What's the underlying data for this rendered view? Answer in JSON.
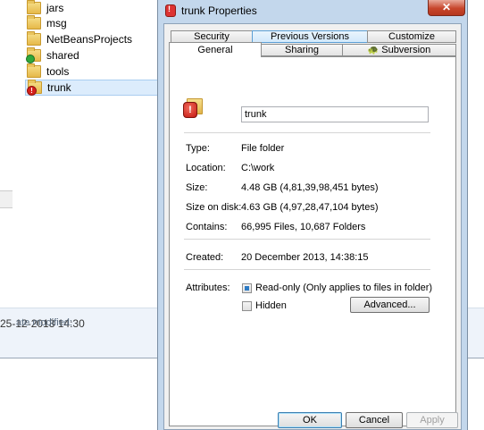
{
  "explorer": {
    "nav_items": [
      {
        "label": "jars",
        "icon": "folder-icon"
      },
      {
        "label": "msg",
        "icon": "folder-icon"
      },
      {
        "label": "NetBeansProjects",
        "icon": "folder-icon"
      },
      {
        "label": "shared",
        "icon": "folder-synced-icon"
      },
      {
        "label": "tools",
        "icon": "folder-icon"
      },
      {
        "label": "trunk",
        "icon": "folder-conflict-icon",
        "selected": true
      }
    ],
    "details": {
      "date_modified_label": "ate modified:",
      "date_modified_value": "25-12-2013 14:30"
    }
  },
  "dialog": {
    "title": "trunk Properties",
    "close_glyph": "✕",
    "tabs_row1": [
      "Security",
      "Previous Versions",
      "Customize"
    ],
    "tabs_row2": [
      "General",
      "Sharing",
      "Subversion"
    ],
    "active_tab": "General",
    "general": {
      "name_value": "trunk",
      "rows": [
        {
          "label": "Type:",
          "value": "File folder"
        },
        {
          "label": "Location:",
          "value": "C:\\work"
        },
        {
          "label": "Size:",
          "value": "4.48 GB (4,81,39,98,451 bytes)"
        },
        {
          "label": "Size on disk:",
          "value": "4.63 GB (4,97,28,47,104 bytes)"
        },
        {
          "label": "Contains:",
          "value": "66,995 Files, 10,687 Folders"
        }
      ],
      "created_label": "Created:",
      "created_value": "20 December 2013, 14:38:15",
      "attributes_label": "Attributes:",
      "readonly_label": "Read-only (Only applies to files in folder)",
      "readonly_state": "indeterminate",
      "hidden_label": "Hidden",
      "hidden_state": "unchecked",
      "advanced_label": "Advanced..."
    },
    "buttons": {
      "ok": "OK",
      "cancel": "Cancel",
      "apply": "Apply"
    }
  },
  "colors": {
    "dialog_frame": "#c3d7ec",
    "close_button": "#c7462c",
    "tab_highlight": "#d2e9fb",
    "details_pane": "#eef3fa"
  }
}
